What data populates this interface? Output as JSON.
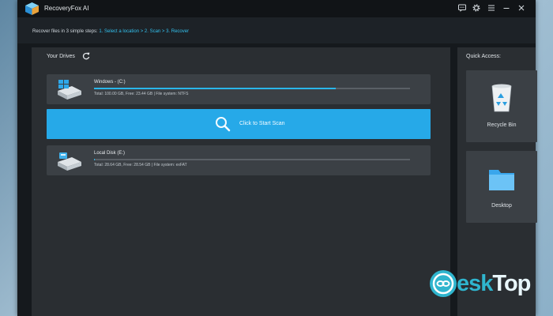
{
  "app": {
    "title": "RecoveryFox AI"
  },
  "steps": {
    "prefix": "Recover files in 3 simple steps:",
    "highlight": "1. Select a location > 2. Scan > 3. Recover"
  },
  "drives_section": {
    "title": "Your Drives"
  },
  "drives": [
    {
      "name": "Windows - (C:)",
      "info": "Total: 100.00 GB, Free: 23.44 GB | File system: NTFS",
      "used_fraction": 0.766
    },
    {
      "name": "Local Disk (E:)",
      "info": "Total: 28.64 GB, Free: 28.54 GB | File system: exFAT",
      "used_fraction": 0.003
    }
  ],
  "scan": {
    "label": "Click to Start Scan"
  },
  "quick_access": {
    "title": "Quick Access:",
    "items": [
      {
        "label": "Recycle Bin",
        "icon": "recycle-bin-icon"
      },
      {
        "label": "Desktop",
        "icon": "folder-icon"
      }
    ]
  },
  "watermark": {
    "text_a": "esk",
    "text_b": "Top"
  },
  "colors": {
    "accent": "#26a9e8",
    "panel": "#2a2e32",
    "card": "#3b4045",
    "titlebar": "#111417"
  }
}
